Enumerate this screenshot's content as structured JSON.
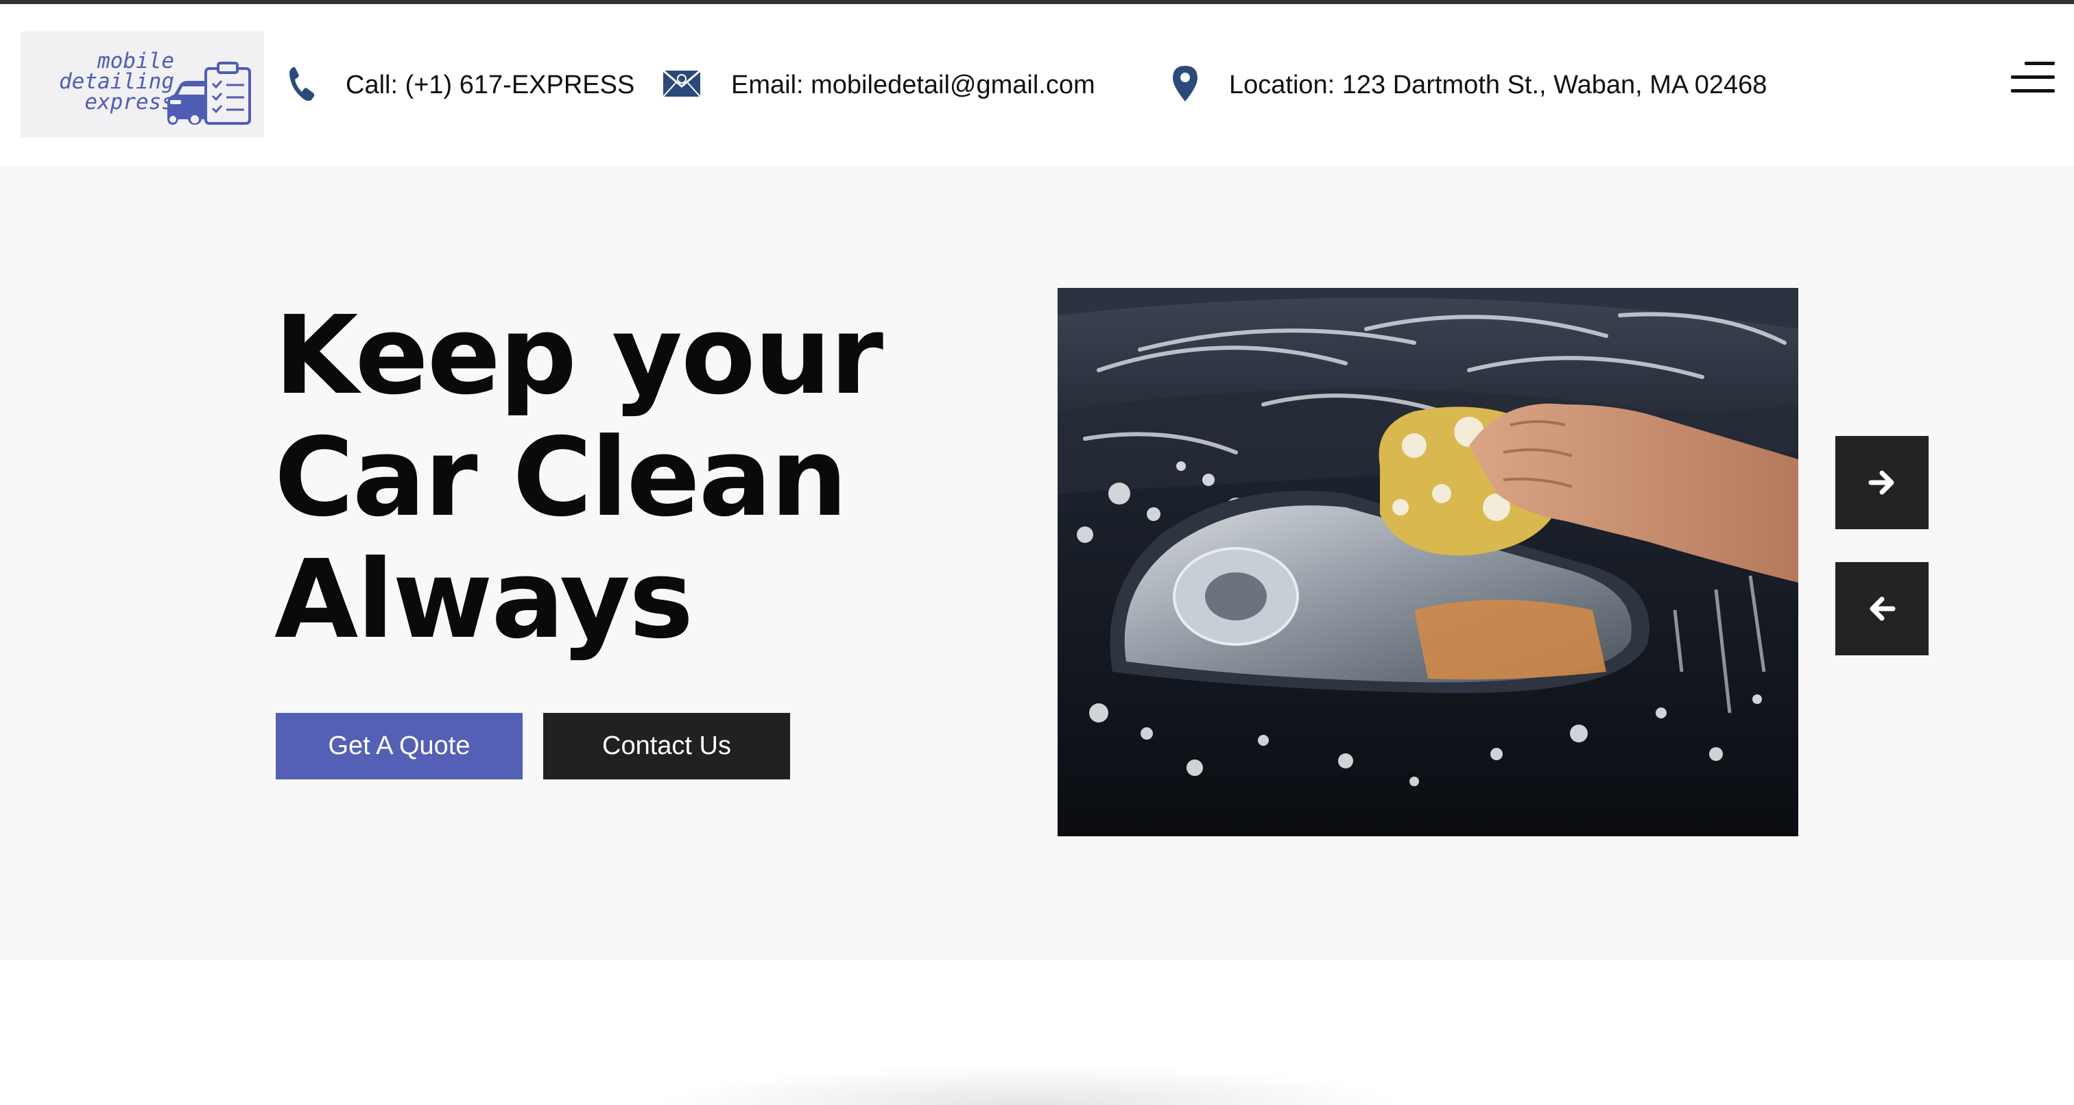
{
  "logo": {
    "lines": [
      "mobile",
      "detailing",
      "express"
    ],
    "icon": "car-clipboard-icon",
    "color": "#4f5db5"
  },
  "contact_bar": {
    "phone": {
      "icon": "phone-icon",
      "label": "Call: (+1) 617-EXPRESS"
    },
    "email": {
      "icon": "envelope-icon",
      "label": "Email: mobiledetail@gmail.com"
    },
    "location": {
      "icon": "map-pin-icon",
      "label": "Location: 123 Dartmoth St., Waban, MA 02468"
    },
    "icon_color": "#2b4a7a"
  },
  "menu": {
    "icon": "hamburger-menu-icon"
  },
  "hero": {
    "headline": [
      "Keep your",
      "Car Clean",
      "Always"
    ],
    "buttons": {
      "quote": "Get A Quote",
      "contact": "Contact Us"
    },
    "image": "car-headlight-washing-photo",
    "carousel": {
      "next_icon": "arrow-right-icon",
      "prev_icon": "arrow-left-icon"
    }
  },
  "colors": {
    "accent": "#5460b5",
    "dark": "#212121",
    "hero_bg": "#f8f8f8"
  }
}
